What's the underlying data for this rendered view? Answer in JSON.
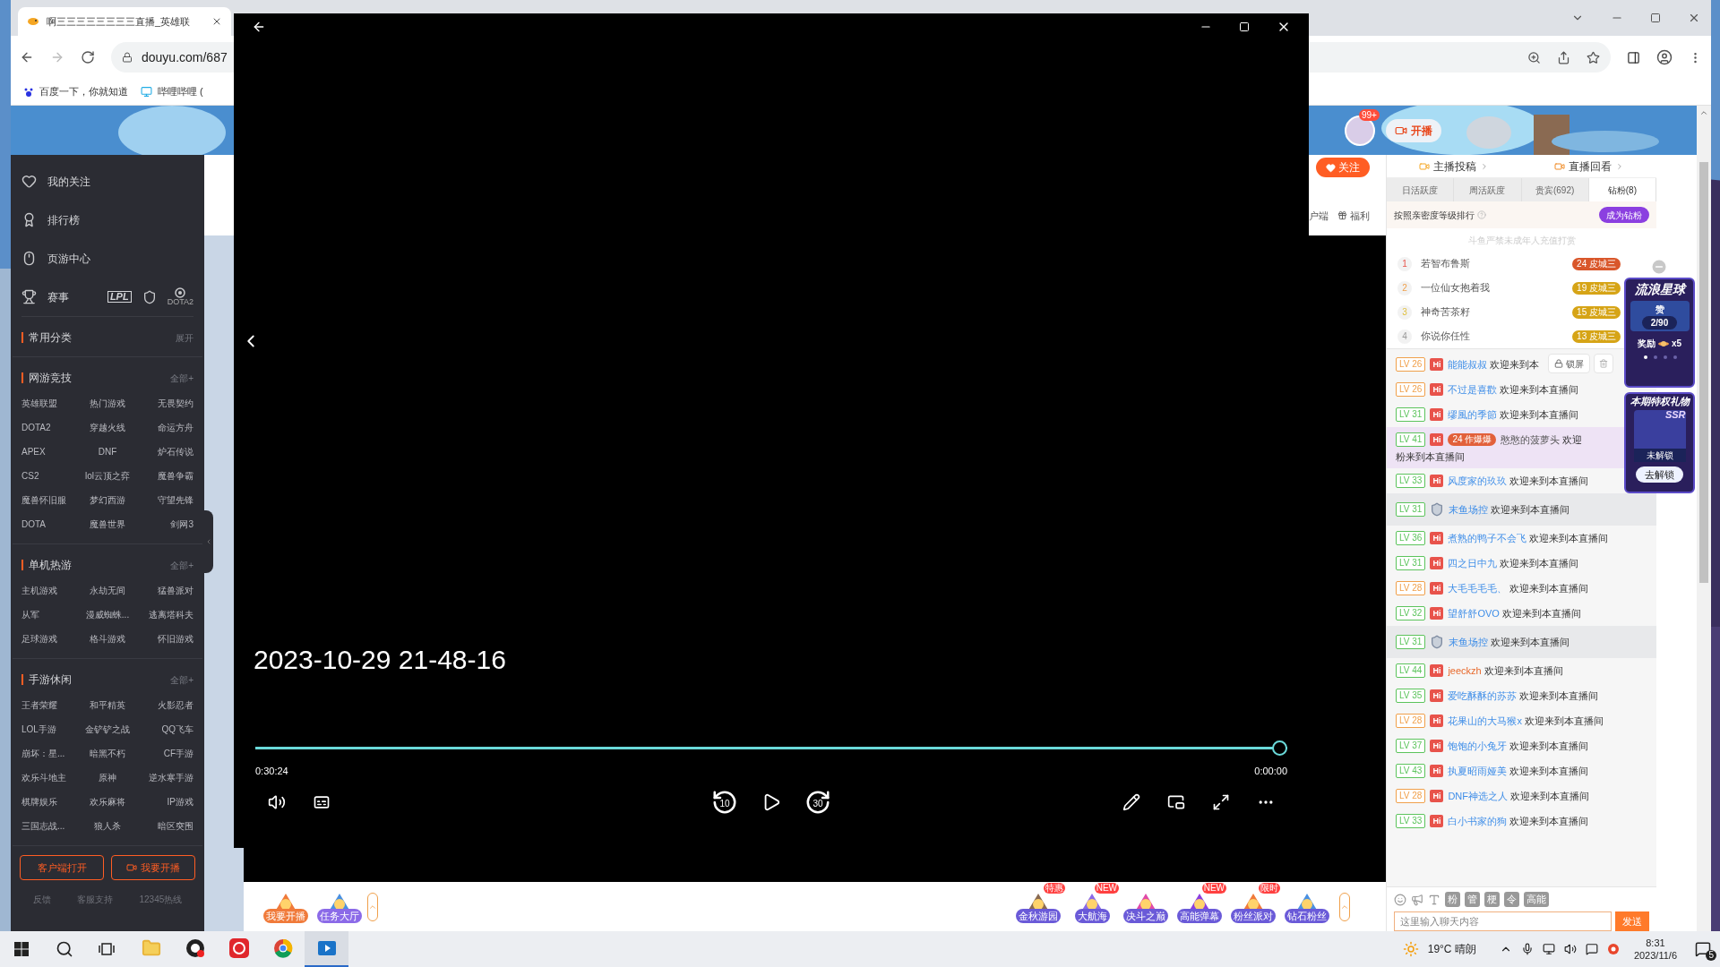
{
  "browser": {
    "tab_title": "啊三三三三三三三三直播_英雄联",
    "address": "douyu.com/687",
    "bookmarks": [
      "百度一下，你就知道",
      "哔哩哔哩 ("
    ]
  },
  "header": {
    "avatar_badge": "99+",
    "live_button": "开播"
  },
  "sidebar": {
    "nav": [
      {
        "label": "我的关注",
        "kind": "heart"
      },
      {
        "label": "排行榜",
        "kind": "rank"
      },
      {
        "label": "页游中心",
        "kind": "mouse"
      },
      {
        "label": "赛事",
        "kind": "trophy"
      }
    ],
    "event_logos": {
      "lpl": "LPL",
      "dota": "DOTA2"
    },
    "sections": [
      {
        "title": "常用分类",
        "action": "展开"
      },
      {
        "title": "网游竞技",
        "action": "全部+",
        "items": [
          "英雄联盟",
          "热门游戏",
          "无畏契约",
          "DOTA2",
          "穿越火线",
          "命运方舟",
          "APEX",
          "DNF",
          "炉石传说",
          "CS2",
          "lol云顶之弈",
          "魔兽争霸",
          "魔兽怀旧服",
          "梦幻西游",
          "守望先锋",
          "DOTA",
          "魔兽世界",
          "剑网3"
        ]
      },
      {
        "title": "单机热游",
        "action": "全部+",
        "items": [
          "主机游戏",
          "永劫无间",
          "猛兽派对",
          "从军",
          "漫威蜘蛛...",
          "逃离塔科夫",
          "足球游戏",
          "格斗游戏",
          "怀旧游戏"
        ]
      },
      {
        "title": "手游休闲",
        "action": "全部+",
        "items": [
          "王者荣耀",
          "和平精英",
          "火影忍者",
          "LOL手游",
          "金铲铲之战",
          "QQ飞车",
          "崩坏：星...",
          "暗黑不朽",
          "CF手游",
          "欢乐斗地主",
          "原神",
          "逆水寒手游",
          "棋牌娱乐",
          "欢乐麻将",
          "IP游戏",
          "三国志战...",
          "狼人杀",
          "暗区突围"
        ]
      }
    ],
    "buttons": [
      "客户端打开",
      "我要开播"
    ],
    "footer": [
      "反馈",
      "客服支持",
      "12345热线"
    ]
  },
  "room": {
    "follow_button": "关注",
    "links": [
      "户端",
      "福利"
    ]
  },
  "chat": {
    "links": [
      "主播投稿",
      "直播回看"
    ],
    "tabs": [
      {
        "label": "日活跃度",
        "selected": false
      },
      {
        "label": "周活跃度",
        "selected": false
      },
      {
        "label": "贵宾(692)",
        "selected": false
      },
      {
        "label": "钻粉(8)",
        "selected": true
      }
    ],
    "rank_hint": "按照亲密度等级排行",
    "become_button": "成为钻粉",
    "notice": "斗鱼严禁未成年人充值打赏",
    "ranking": [
      {
        "rank": "1",
        "name": "若智布鲁斯",
        "badge_level": "24",
        "badge_name": "皮城三",
        "color": "#d9572b"
      },
      {
        "rank": "2",
        "name": "一位仙女抱着我",
        "badge_level": "19",
        "badge_name": "皮城三",
        "color": "#d6a416"
      },
      {
        "rank": "3",
        "name": "神奇苦茶籽",
        "badge_level": "15",
        "badge_name": "皮城三",
        "color": "#d6a416"
      },
      {
        "rank": "4",
        "name": "你说你任性",
        "badge_level": "13",
        "badge_name": "皮城三",
        "color": "#d6a416"
      }
    ],
    "lock_button": "锁屏",
    "messages": [
      {
        "kind": "normal",
        "level": "LV 26",
        "color": "#f0a04b",
        "badge": "Hi",
        "name": "能能叔叔",
        "highlight_name": false,
        "text": "欢迎来到本"
      },
      {
        "kind": "normal",
        "level": "LV 26",
        "color": "#f0a04b",
        "badge": "Hi",
        "name": "不过是喜歡",
        "highlight_name": false,
        "text": "欢迎来到本直播间"
      },
      {
        "kind": "normal",
        "level": "LV 31",
        "color": "#5cc45c",
        "badge": "Hi",
        "name": "缪風的季節",
        "highlight_name": false,
        "text": "欢迎来到本直播间"
      },
      {
        "kind": "fan",
        "level": "LV 41",
        "color": "#5cc45c",
        "badge": "Hi",
        "fan_level": "24",
        "fan_name": "作爆爆",
        "name": "憨憨的菠萝头",
        "highlight_name": false,
        "text": "欢迎",
        "text2": "粉来到本直播间"
      },
      {
        "kind": "normal",
        "level": "LV 33",
        "color": "#5cc45c",
        "badge": "Hi",
        "name": "风度家的玖玖",
        "highlight_name": false,
        "text": "欢迎来到本直播间"
      },
      {
        "kind": "noble",
        "level": "LV 31",
        "color": "#5cc45c",
        "name": "末鱼场控",
        "highlight_name": false,
        "text": "欢迎来到本直播间"
      },
      {
        "kind": "normal",
        "level": "LV 36",
        "color": "#5cc45c",
        "badge": "Hi",
        "name": "煮熟的鸭子不会飞",
        "highlight_name": false,
        "text": "欢迎来到本直播间"
      },
      {
        "kind": "normal",
        "level": "LV 31",
        "color": "#5cc45c",
        "badge": "Hi",
        "name": "四之日中九",
        "highlight_name": false,
        "text": "欢迎来到本直播间"
      },
      {
        "kind": "normal",
        "level": "LV 28",
        "color": "#f0a04b",
        "badge": "Hi",
        "name": "大毛毛毛毛、",
        "highlight_name": false,
        "text": "欢迎来到本直播间"
      },
      {
        "kind": "normal",
        "level": "LV 32",
        "color": "#5cc45c",
        "badge": "Hi",
        "name": "望舒舒OVO",
        "highlight_name": false,
        "text": "欢迎来到本直播间"
      },
      {
        "kind": "noble",
        "level": "LV 31",
        "color": "#5cc45c",
        "name": "末鱼场控",
        "highlight_name": false,
        "text": "欢迎来到本直播间"
      },
      {
        "kind": "normal",
        "level": "LV 44",
        "color": "#5cc45c",
        "badge": "Hi",
        "name": "jeeckzh",
        "highlight_name": true,
        "text": "欢迎来到本直播间"
      },
      {
        "kind": "normal",
        "level": "LV 35",
        "color": "#5cc45c",
        "badge": "Hi",
        "name": "爱吃酥酥的苏苏",
        "highlight_name": false,
        "text": "欢迎来到本直播间"
      },
      {
        "kind": "normal",
        "level": "LV 28",
        "color": "#f0a04b",
        "badge": "Hi",
        "name": "花果山的大马猴x",
        "highlight_name": false,
        "text": "欢迎来到本直播间"
      },
      {
        "kind": "normal",
        "level": "LV 37",
        "color": "#5cc45c",
        "badge": "Hi",
        "name": "饱饱的小兔牙",
        "highlight_name": false,
        "text": "欢迎来到本直播间"
      },
      {
        "kind": "normal",
        "level": "LV 43",
        "color": "#5cc45c",
        "badge": "Hi",
        "name": "执夏昭雨娅美",
        "highlight_name": false,
        "text": "欢迎来到本直播间"
      },
      {
        "kind": "normal",
        "level": "LV 28",
        "color": "#f0a04b",
        "badge": "Hi",
        "name": "DNF神选之人",
        "highlight_name": false,
        "text": "欢迎来到本直播间"
      },
      {
        "kind": "normal",
        "level": "LV 33",
        "color": "#5cc45c",
        "badge": "Hi",
        "name": "白小书家的狗",
        "highlight_name": false,
        "text": "欢迎来到本直播间"
      }
    ],
    "tools": [
      "粉",
      "管",
      "梗",
      "令",
      "高能"
    ],
    "input_placeholder": "这里输入聊天内容",
    "send_button": "发送"
  },
  "promo": {
    "planet_title": "流浪星球",
    "like": "赞",
    "progress": "2/90",
    "reward": "奖励",
    "reward_count": "x5",
    "gift_title": "本期特权礼物",
    "tier": "SSR",
    "locked": "未解锁",
    "unlock_button": "去解锁"
  },
  "gift_bar": {
    "left": [
      "我要开播",
      "任务大厅"
    ],
    "right": [
      {
        "label": "金秋游园",
        "tag": "特惠"
      },
      {
        "label": "大航海",
        "tag": "NEW"
      },
      {
        "label": "决斗之巅"
      },
      {
        "label": "高能弹幕",
        "tag": "NEW"
      },
      {
        "label": "粉丝派对",
        "tag": "限时"
      },
      {
        "label": "钻石粉丝"
      }
    ]
  },
  "player": {
    "title": "2023-10-29 21-48-16",
    "elapsed": "0:30:24",
    "remaining": "0:00:00",
    "level": 1,
    "skip_back": "10",
    "skip_forward": "30"
  },
  "taskbar": {
    "apps": [
      {
        "kind": "explorer",
        "selected": false
      },
      {
        "kind": "recorder",
        "selected": false
      },
      {
        "kind": "music",
        "selected": false
      },
      {
        "kind": "chrome",
        "selected": false
      },
      {
        "kind": "movies",
        "selected": true
      }
    ],
    "weather": "19°C 晴朗",
    "time": "8:31",
    "date": "2023/11/6",
    "notifications": "5"
  }
}
